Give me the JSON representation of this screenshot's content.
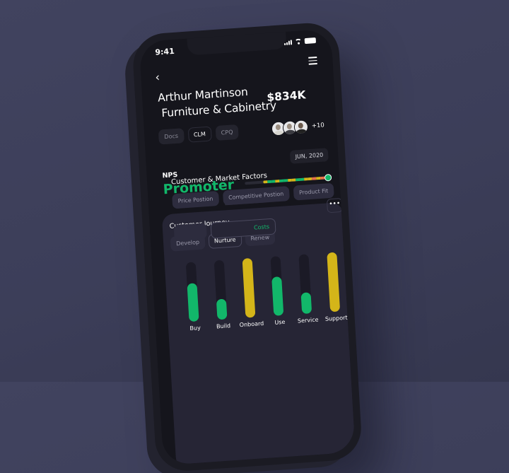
{
  "status_bar": {
    "time": "9:41",
    "icons": [
      "signal-icon",
      "wifi-icon",
      "battery-icon"
    ]
  },
  "nav": {
    "back_icon": "chevron-left",
    "menu_icon": "hamburger-menu"
  },
  "header": {
    "name": "Arthur Martinson",
    "company": "Furniture & Cabinetry",
    "amount": "$834K"
  },
  "tags": [
    {
      "label": "Docs",
      "active": false
    },
    {
      "label": "CLM",
      "active": true
    },
    {
      "label": "CPQ",
      "active": false
    }
  ],
  "team": {
    "avatar_count_shown": 3,
    "more": "+10"
  },
  "nps": {
    "date": "JUN, 2020",
    "label": "NPS",
    "value": "Promoter",
    "segments": [
      "#d4b519",
      "#12b76a",
      "#12b76a",
      "#d4b519",
      "#12b76a",
      "#12b76a",
      "#d4b519",
      "#d4b519",
      "#12b76a",
      "#12b76a",
      "#d4b519",
      "#d4b519",
      "#e8704a",
      "#d4b519",
      "#e8704a",
      "#e8704a"
    ],
    "position": 1.0
  },
  "customer_journey": {
    "title": "Customer Journey",
    "tabs": [
      {
        "label": "Develop",
        "active": false
      },
      {
        "label": "Nurture",
        "active": true
      },
      {
        "label": "Renew",
        "active": false
      }
    ],
    "colors": {
      "good": "#12b76a",
      "warn": "#d4b519",
      "track": "#1b1a26"
    }
  },
  "chart_data": {
    "type": "bar",
    "title": "Customer Journey",
    "categories": [
      "Buy",
      "Build",
      "Onboard",
      "Use",
      "Service",
      "Support"
    ],
    "values": [
      0.64,
      0.35,
      1.0,
      0.66,
      0.36,
      1.0
    ],
    "status": [
      "good",
      "good",
      "warn",
      "good",
      "good",
      "warn"
    ],
    "ylim": [
      0,
      1
    ],
    "xlabel": "",
    "ylabel": ""
  },
  "market_factors": {
    "title": "Customer & Market Factors",
    "chips": [
      "Price Postion",
      "Competitive Postion",
      "Product Fit"
    ],
    "row2": [
      {
        "label": "",
        "highlight": false
      },
      {
        "label": "Costs",
        "highlight": true
      }
    ],
    "more_label": "•••"
  }
}
